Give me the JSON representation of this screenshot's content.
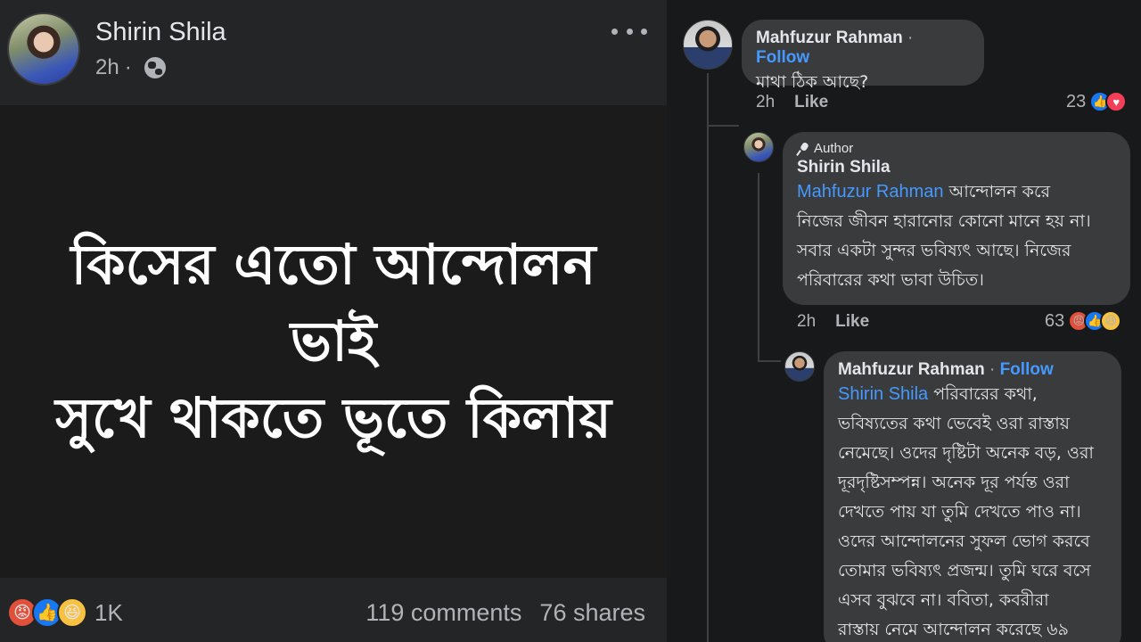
{
  "post": {
    "author": "Shirin Shila",
    "time": "2h",
    "separator": "·",
    "image_lines": [
      "কিসের এতো আন্দোলন",
      "ভাই",
      "সুখে থাকতে ভূতে কিলায়"
    ],
    "reaction_count": "1K",
    "comments": "119 comments",
    "shares": "76 shares"
  },
  "comments": [
    {
      "author": "Mahfuzur Rahman",
      "separator": "·",
      "follow_label": "Follow",
      "text": "মাথা ঠিক আছে?",
      "time": "2h",
      "like_label": "Like",
      "reaction_count": "23"
    },
    {
      "badge": "Author",
      "author": "Shirin Shila",
      "mention": "Mahfuzur Rahman",
      "text_lines": [
        "আন্দোলন করে",
        "নিজের জীবন হারানোর কোনো মানে হয় না।",
        "সবার একটা সুন্দর ভবিষ্যৎ আছে। নিজের",
        "পরিবারের কথা ভাবা উচিত।"
      ],
      "time": "2h",
      "like_label": "Like",
      "reaction_count": "63"
    },
    {
      "author": "Mahfuzur Rahman",
      "separator": "·",
      "follow_label": "Follow",
      "mention": "Shirin Shila",
      "text_lines": [
        "পরিবারের কথা,",
        "ভবিষ্যতের কথা ভেবেই ওরা রাস্তায়",
        "নেমেছে। ওদের দৃষ্টিটা অনেক বড়, ওরা",
        "দূরদৃষ্টিসম্পন্ন। অনেক দূর পর্যন্ত ওরা",
        "দেখতে পায় যা তুমি দেখতে পাও না।",
        "ওদের আন্দোলনের সুফল ভোগ করবে",
        "তোমার ভবিষ্যৎ প্রজন্ম। তুমি ঘরে বসে",
        "এসব বুঝবে না। ববিতা, কবরীরা",
        "রাস্তায় নেমে আন্দোলন করেছে ৬৯"
      ]
    }
  ],
  "icons": {
    "like": "thumbs-up-icon",
    "love": "heart-icon",
    "angry": "angry-face-icon",
    "haha": "laughing-face-icon",
    "privacy": "globe-icon",
    "more": "more-options-icon"
  },
  "colors": {
    "accent": "#4599ff",
    "like": "#1877f2",
    "love": "#f33e58",
    "angry": "#e0503a",
    "haha": "#f7c242"
  }
}
